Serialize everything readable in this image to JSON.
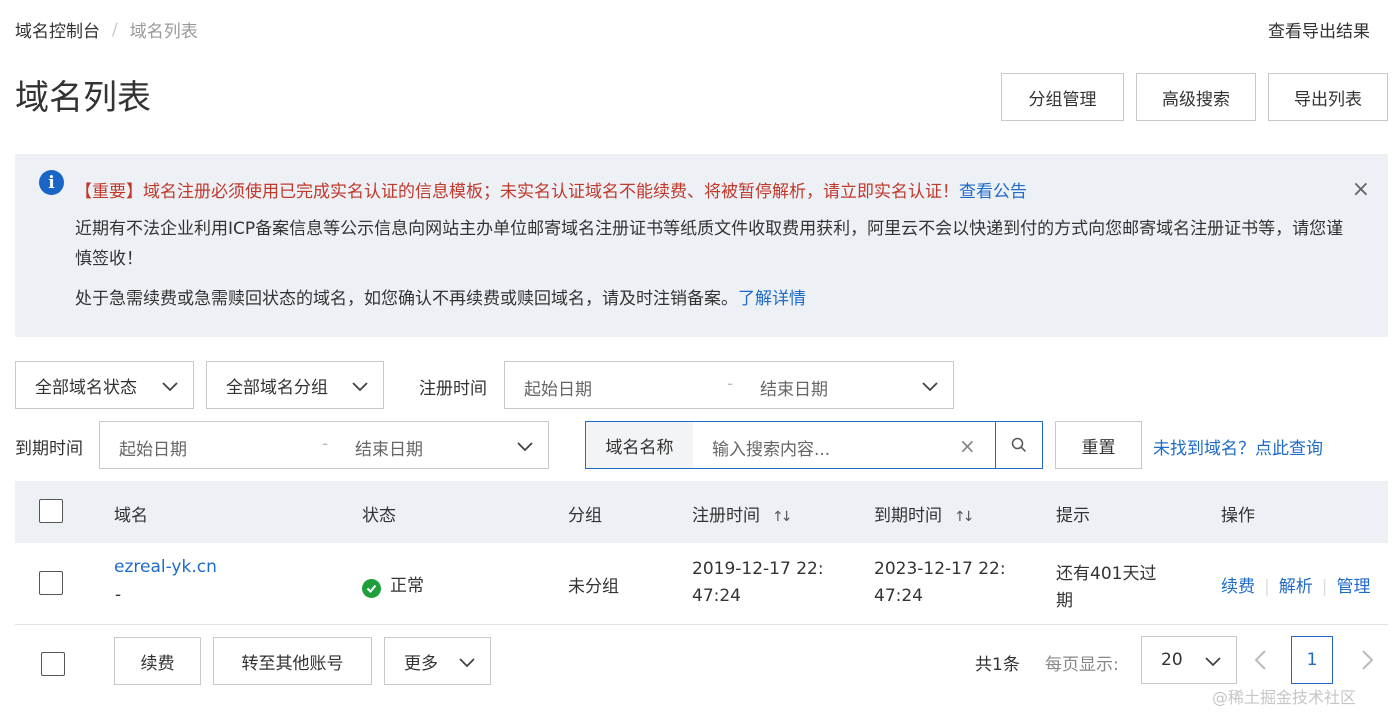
{
  "breadcrumb": {
    "root": "域名控制台",
    "separator": "/",
    "current": "域名列表"
  },
  "header": {
    "export_result": "查看导出结果",
    "title": "域名列表",
    "buttons": {
      "group_manage": "分组管理",
      "advanced_search": "高级搜索",
      "export_list": "导出列表"
    }
  },
  "notice": {
    "line1_text": "【重要】域名注册必须使用已完成实名认证的信息模板；未实名认证域名不能续费、将被暂停解析，请立即实名认证！",
    "line1_link": "查看公告",
    "line2": "近期有不法企业利用ICP备案信息等公示信息向网站主办单位邮寄域名注册证书等纸质文件收取费用获利，阿里云不会以快递到付的方式向您邮寄域名注册证书等，请您谨慎签收！",
    "line3_text": "处于急需续费或急需赎回状态的域名，如您确认不再续费或赎回域名，请及时注销备案。",
    "line3_link": "了解详情",
    "close": "×"
  },
  "filters": {
    "status_select": "全部域名状态",
    "group_select": "全部域名分组",
    "reg_time_label": "注册时间",
    "reg_start": "起始日期",
    "reg_end": "结束日期",
    "range_dash": "-",
    "exp_time_label": "到期时间",
    "exp_start": "起始日期",
    "exp_end": "结束日期",
    "search_prefix": "域名名称",
    "search_placeholder": "输入搜索内容...",
    "clear": "×",
    "reset": "重置",
    "not_found_link": "未找到域名？点此查询"
  },
  "table": {
    "columns": {
      "domain": "域名",
      "status": "状态",
      "group": "分组",
      "reg_time": "注册时间",
      "exp_time": "到期时间",
      "hint": "提示",
      "actions": "操作"
    },
    "sort_icon": "↑↓",
    "rows": [
      {
        "domain": "ezreal-yk.cn",
        "sub": "-",
        "status": "正常",
        "group": "未分组",
        "reg_time_1": "2019-12-17 22:",
        "reg_time_2": "47:24",
        "exp_time_1": "2023-12-17 22:",
        "exp_time_2": "47:24",
        "hint_1": "还有401天过",
        "hint_2": "期",
        "actions": {
          "renew": "续费",
          "resolve": "解析",
          "manage": "管理"
        }
      }
    ],
    "action_sep": "|"
  },
  "footer": {
    "renew": "续费",
    "transfer": "转至其他账号",
    "more": "更多",
    "total": "共1条",
    "per_page_label": "每页显示:",
    "per_page_value": "20",
    "current_page": "1"
  },
  "watermark": "@稀土掘金技术社区",
  "colors": {
    "link": "#1f6bc9",
    "notice_bg": "#edf1f6",
    "important_red": "#c0392b",
    "status_green": "#1f9f3c"
  }
}
